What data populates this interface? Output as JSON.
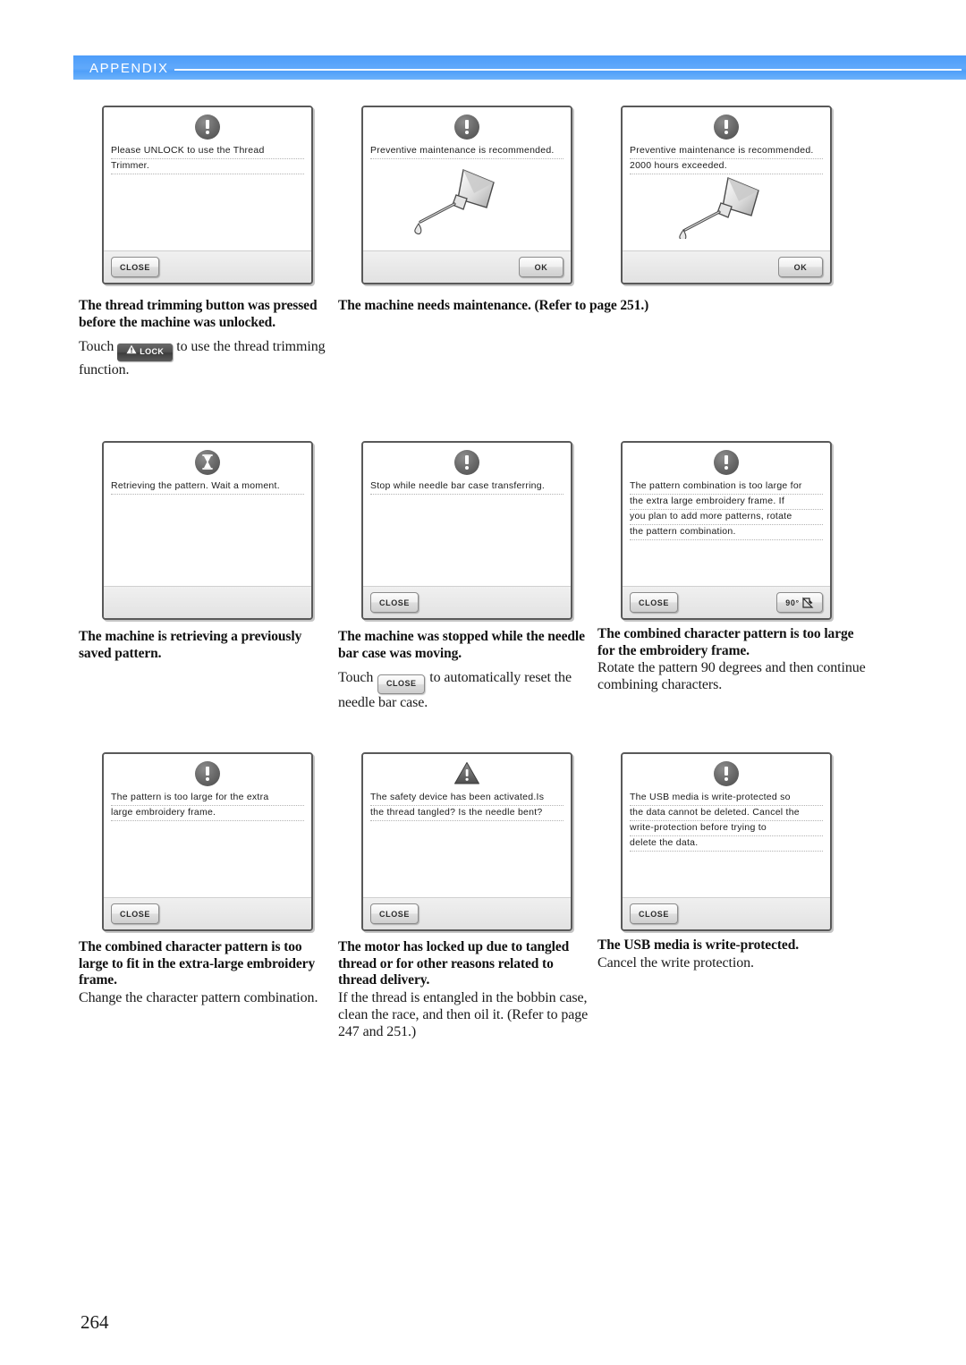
{
  "header": {
    "section_label": "APPENDIX"
  },
  "page_number": "264",
  "rows": [
    {
      "cells": [
        {
          "dialog": {
            "icon": "exclamation-circle-icon",
            "lines": [
              "Please UNLOCK to use the Thread",
              "Trimmer."
            ],
            "buttons": [
              {
                "label": "CLOSE",
                "position": "left",
                "kind": "close"
              }
            ]
          },
          "caption": {
            "heading": "The thread trimming button was pressed before the machine was unlocked.",
            "body_pre": "Touch",
            "inline_button": {
              "label": "LOCK",
              "icon": "warning-triangle-icon"
            },
            "body_post": "to use the thread trimming function."
          }
        },
        {
          "dialog": {
            "icon": "exclamation-circle-icon",
            "lines": [
              "Preventive maintenance is recommended."
            ],
            "illustration": "oil-bottle-icon",
            "buttons": [
              {
                "label": "OK",
                "position": "right",
                "kind": "ok"
              }
            ]
          },
          "caption": {
            "heading": "The machine needs maintenance. (Refer to page 251.)",
            "body_pre": "",
            "body_post": ""
          }
        },
        {
          "dialog": {
            "icon": "exclamation-circle-icon",
            "lines": [
              "Preventive maintenance is recommended.",
              "2000 hours exceeded."
            ],
            "illustration": "oil-bottle-icon",
            "buttons": [
              {
                "label": "OK",
                "position": "right",
                "kind": "ok"
              }
            ]
          },
          "caption": null
        }
      ]
    },
    {
      "cells": [
        {
          "dialog": {
            "icon": "hourglass-icon",
            "lines": [
              "Retrieving the pattern. Wait a moment."
            ],
            "buttons": []
          },
          "caption": {
            "heading": "The machine is retrieving a previously saved pattern.",
            "body_pre": "",
            "body_post": ""
          }
        },
        {
          "dialog": {
            "icon": "exclamation-circle-icon",
            "lines": [
              "Stop while needle bar case transferring."
            ],
            "buttons": [
              {
                "label": "CLOSE",
                "position": "left",
                "kind": "close"
              }
            ]
          },
          "caption": {
            "heading": "The machine was stopped while the needle bar case was moving.",
            "body_pre": "Touch",
            "inline_button": {
              "label": "CLOSE",
              "icon": null
            },
            "body_post": "to automatically reset the needle bar case."
          }
        },
        {
          "dialog": {
            "icon": "exclamation-circle-icon",
            "lines": [
              "The pattern combination is too large for",
              "the extra large embroidery frame. If",
              "you plan to add more patterns, rotate",
              "the pattern combination."
            ],
            "buttons": [
              {
                "label": "CLOSE",
                "position": "left",
                "kind": "close"
              },
              {
                "label": "90°",
                "position": "right",
                "kind": "rotate"
              }
            ]
          },
          "caption": {
            "heading": "The combined character pattern is too large for the embroidery frame.",
            "body_post": "Rotate the pattern 90 degrees and then continue combining characters."
          }
        }
      ]
    },
    {
      "cells": [
        {
          "dialog": {
            "icon": "exclamation-circle-icon",
            "lines": [
              "The pattern is too large for the extra",
              "large embroidery frame."
            ],
            "buttons": [
              {
                "label": "CLOSE",
                "position": "left",
                "kind": "close"
              }
            ]
          },
          "caption": {
            "heading": "The combined character pattern is too large to fit in the extra-large embroidery frame.",
            "body_post": "Change the character pattern combination."
          }
        },
        {
          "dialog": {
            "icon": "warning-triangle-icon",
            "lines": [
              "The safety device has been activated.Is",
              "the thread tangled? Is the needle bent?"
            ],
            "buttons": [
              {
                "label": "CLOSE",
                "position": "left",
                "kind": "close"
              }
            ]
          },
          "caption": {
            "heading": "The motor has locked up due to tangled thread or for other reasons related to thread delivery.",
            "body_post": "If the thread is entangled in the bobbin case, clean the race, and then oil it. (Refer to page 247 and 251.)"
          }
        },
        {
          "dialog": {
            "icon": "exclamation-circle-icon",
            "lines": [
              "The USB media is write-protected so",
              "the data cannot be deleted. Cancel the",
              "write-protection before trying to",
              "delete the data."
            ],
            "buttons": [
              {
                "label": "CLOSE",
                "position": "left",
                "kind": "close"
              }
            ]
          },
          "caption": {
            "heading": "The USB media is write-protected.",
            "body_post": "Cancel the write protection."
          }
        }
      ]
    }
  ],
  "colors": {
    "banner": "#4d9dfa",
    "dialog_border": "#595959",
    "text": "#1a1a1a"
  }
}
